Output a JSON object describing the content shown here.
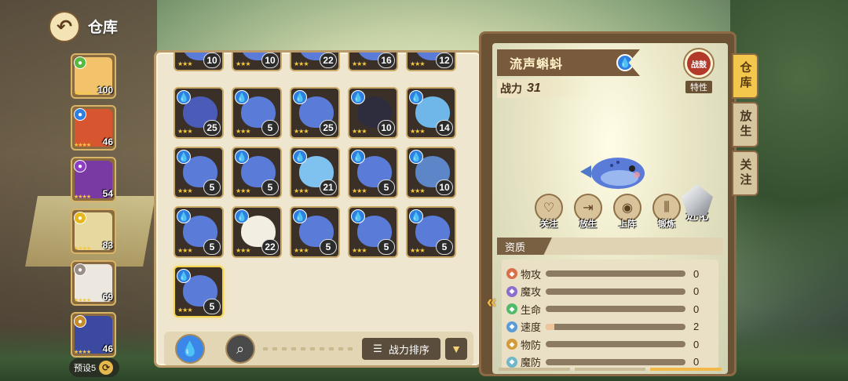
{
  "header": {
    "title": "仓库"
  },
  "team": {
    "slots": [
      {
        "level": "100",
        "element_color": "#58b846",
        "art_color": "#f2c36b"
      },
      {
        "level": "46",
        "element_color": "#2f7fe0",
        "art_color": "#d8562f"
      },
      {
        "level": "54",
        "element_color": "#8b3fc7",
        "art_color": "#7a3aa3"
      },
      {
        "level": "83",
        "element_color": "#e6b81d",
        "art_color": "#e7d8a0"
      },
      {
        "level": "69",
        "element_color": "#9a8f86",
        "art_color": "#ece7df"
      },
      {
        "level": "46",
        "element_color": "#c58a2a",
        "art_color": "#3b4aa0"
      }
    ],
    "preset_label": "预设5"
  },
  "inventory": {
    "top_row_levels": [
      "10",
      "10",
      "22",
      "16",
      "12"
    ],
    "rows": [
      [
        {
          "level": "25",
          "art": "#4a5bb8"
        },
        {
          "level": "5",
          "art": "#5b7bd8"
        },
        {
          "level": "25",
          "art": "#5b7bd8"
        },
        {
          "level": "10",
          "art": "#2d2d3d"
        },
        {
          "level": "14",
          "art": "#6fb7e9"
        }
      ],
      [
        {
          "level": "5",
          "art": "#5b7bd8"
        },
        {
          "level": "5",
          "art": "#5b7bd8"
        },
        {
          "level": "21",
          "art": "#7fc2ef"
        },
        {
          "level": "5",
          "art": "#5b7bd8"
        },
        {
          "level": "10",
          "art": "#5d86c9"
        }
      ],
      [
        {
          "level": "5",
          "art": "#5b7bd8"
        },
        {
          "level": "22",
          "art": "#f3eee2"
        },
        {
          "level": "5",
          "art": "#5b7bd8"
        },
        {
          "level": "5",
          "art": "#5b7bd8"
        },
        {
          "level": "5",
          "art": "#5b7bd8"
        }
      ],
      [
        {
          "level": "5",
          "art": "#5b7bd8",
          "selected": true
        }
      ]
    ],
    "sort_label": "战力排序"
  },
  "detail": {
    "name": "流声蝌蚪",
    "power_label": "战力",
    "power_value": "31",
    "trait_badge": "战鼓",
    "trait_label": "特性",
    "actions": {
      "follow": "关注",
      "release": "放生",
      "deploy": "上阵",
      "train": "锻炼",
      "evolve": "进化"
    },
    "stats_title": "资质",
    "stats": [
      {
        "name": "物攻",
        "value": "0",
        "fill": 0,
        "icon_color": "#d9704a"
      },
      {
        "name": "魔攻",
        "value": "0",
        "fill": 0,
        "icon_color": "#8b6fcf"
      },
      {
        "name": "生命",
        "value": "0",
        "fill": 0,
        "icon_color": "#4fba6a"
      },
      {
        "name": "速度",
        "value": "2",
        "fill": 0.06,
        "icon_color": "#5a9bd8"
      },
      {
        "name": "物防",
        "value": "0",
        "fill": 0,
        "icon_color": "#d39a3a"
      },
      {
        "name": "魔防",
        "value": "0",
        "fill": 0,
        "icon_color": "#6fb7c9"
      }
    ]
  },
  "side_tabs": [
    {
      "label": "仓库",
      "active": true
    },
    {
      "label": "放生",
      "active": false
    },
    {
      "label": "关注",
      "active": false
    }
  ]
}
